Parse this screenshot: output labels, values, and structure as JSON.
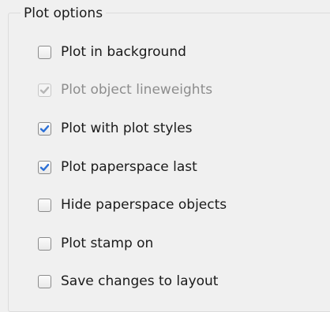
{
  "group": {
    "title": "Plot options"
  },
  "options": [
    {
      "label": "Plot in background",
      "checked": false,
      "enabled": true
    },
    {
      "label": "Plot object lineweights",
      "checked": true,
      "enabled": false
    },
    {
      "label": "Plot with plot styles",
      "checked": true,
      "enabled": true
    },
    {
      "label": "Plot paperspace last",
      "checked": true,
      "enabled": true
    },
    {
      "label": "Hide paperspace objects",
      "checked": false,
      "enabled": true
    },
    {
      "label": "Plot stamp on",
      "checked": false,
      "enabled": true
    },
    {
      "label": "Save changes to layout",
      "checked": false,
      "enabled": true
    }
  ],
  "icons": {
    "checkmark": "checkmark-icon"
  },
  "colors": {
    "check_enabled": "#2b6fd6",
    "check_disabled": "#b5b5b5"
  }
}
